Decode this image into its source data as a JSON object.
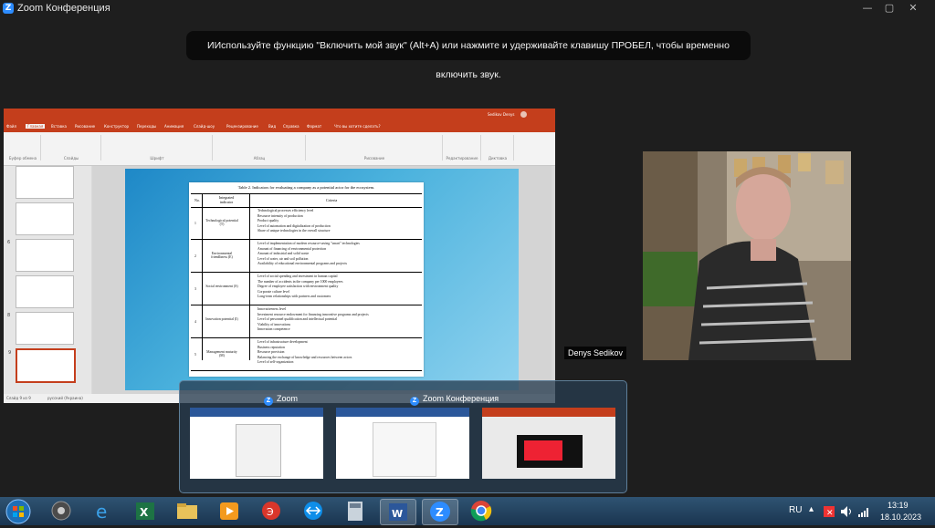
{
  "window": {
    "title": "Zoom Конференция",
    "logo_letter": "Z",
    "minimize": "—",
    "maximize": "▢",
    "close": "✕"
  },
  "notification": {
    "text": "ИИспользуйте функцию \"Включить мой звук\" (Alt+A) или нажмите и удерживайте клавишу ПРОБЕЛ, чтобы временно включить звук."
  },
  "shared_screen": {
    "app": "PowerPoint",
    "user": "Sedikov Denys",
    "tabs": [
      "Файл",
      "Главная",
      "Вставка",
      "Рисование",
      "Конструктор",
      "Переходы",
      "Анимация",
      "Слайд-шоу",
      "Рецензирование",
      "Вид",
      "Справка",
      "Формат"
    ],
    "search_hint": "Что вы хотите сделать?",
    "ribbon_groups": [
      "Буфер обмена",
      "Слайды",
      "Шрифт",
      "Абзац",
      "Рисование",
      "Редактирование",
      "Диктовка"
    ],
    "slide_numbers": [
      "",
      "",
      "6",
      "",
      "8",
      "9"
    ],
    "status_left": "Слайд 9 из 9",
    "status_lang": "русский (Украина)",
    "table": {
      "title": "Table 2. Indicators for evaluating a company as a potential actor for the ecosystem.",
      "headers": {
        "no": "No.",
        "indicator": "Integrated indicator",
        "criteria": "Criteria"
      },
      "rows": [
        {
          "no": "1",
          "indicator": "Technological potential (T)",
          "criteria": [
            "Technological processes efficiency level",
            "Resource intensity of production",
            "Product quality",
            "Level of automation and digitalization of production",
            "Share of unique technologies in the overall structure"
          ]
        },
        {
          "no": "2",
          "indicator": "Environmental friendliness (E)",
          "criteria": [
            "Level of implementation of modern resource-saving \"smart\" technologies",
            "Amount of financing of environmental protection",
            "Amount of industrial and solid waste",
            "Level of water, air and soil pollution",
            "Availability of educational environmental programs and projects"
          ]
        },
        {
          "no": "3",
          "indicator": "Social environment (S)",
          "criteria": [
            "Level of social spending and investment in human capital",
            "The number of accidents in the company per 1000 employees",
            "Degree of employee satisfaction with environment quality",
            "Corporate culture level",
            "Long-term relationships with partners and customers"
          ]
        },
        {
          "no": "4",
          "indicator": "Innovation potential (I)",
          "criteria": [
            "Innovativeness level",
            "Investment resource endowment for financing innovative programs and projects",
            "Level of personnel qualification and intellectual potential",
            "Viability of innovations",
            "Innovation competence"
          ]
        },
        {
          "no": "5",
          "indicator": "Management maturity (M)",
          "criteria": [
            "Level of infrastructure development",
            "Business reputation",
            "Resource provision",
            "Balancing the exchange of knowledge and resources between actors",
            "Level of self-organization"
          ]
        }
      ]
    }
  },
  "video": {
    "participant": "Denys Sedikov"
  },
  "taskbar_preview": {
    "groups": [
      "Zoom",
      "Zoom Конференция"
    ]
  },
  "taskbar": {
    "language": "RU",
    "time": "13:19",
    "date": "18.10.2023"
  },
  "colors": {
    "ppt_accent": "#c43e1c",
    "zoom_blue": "#2d8cff",
    "taskbar": "#1a3550"
  }
}
